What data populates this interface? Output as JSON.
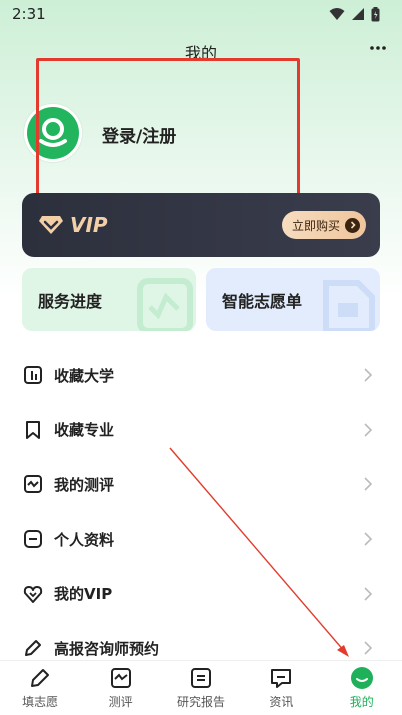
{
  "status_bar": {
    "time": "2:31"
  },
  "header": {
    "title": "我的"
  },
  "profile": {
    "login_label": "登录/注册"
  },
  "vip_card": {
    "label": "VIP",
    "buy_label": "立即购买"
  },
  "quick_cards": [
    {
      "label": "服务进度"
    },
    {
      "label": "智能志愿单"
    }
  ],
  "menu": [
    {
      "label": "收藏大学",
      "icon": "building-icon"
    },
    {
      "label": "收藏专业",
      "icon": "bookmark-icon"
    },
    {
      "label": "我的测评",
      "icon": "chart-icon"
    },
    {
      "label": "个人资料",
      "icon": "minus-box-icon"
    },
    {
      "label": "我的VIP",
      "icon": "vip-heart-icon"
    },
    {
      "label": "高报咨询师预约",
      "icon": "pencil-icon"
    }
  ],
  "tabs": [
    {
      "label": "填志愿",
      "icon": "pencil-icon"
    },
    {
      "label": "测评",
      "icon": "chart-icon"
    },
    {
      "label": "研究报告",
      "icon": "report-icon"
    },
    {
      "label": "资讯",
      "icon": "message-icon"
    },
    {
      "label": "我的",
      "icon": "smile-icon",
      "active": true
    }
  ],
  "colors": {
    "accent": "#1fb15a",
    "annotation": "#e23b2e",
    "vip_gold": "#f3cfa8"
  }
}
